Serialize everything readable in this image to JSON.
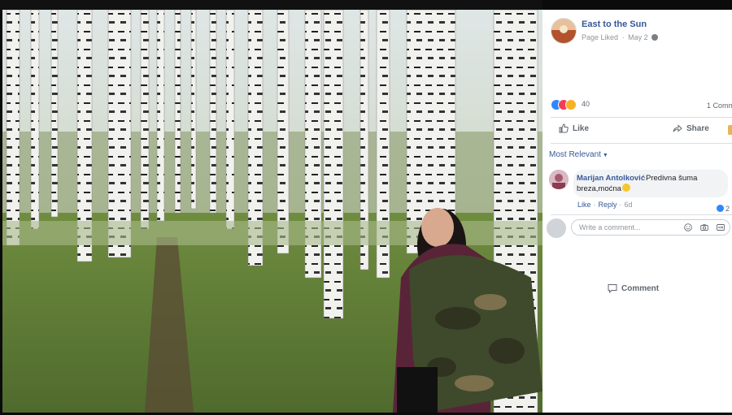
{
  "page": {
    "name": "East to the Sun",
    "status": "Page Liked",
    "separator": "·",
    "date": "May 2"
  },
  "reactions": {
    "count": "40",
    "comments_label": "1 Comm",
    "types": [
      "like",
      "love",
      "wow"
    ]
  },
  "actions": {
    "like": "Like",
    "comment": "Comment",
    "share": "Share"
  },
  "sort": {
    "label": "Most Relevant",
    "caret": "▼"
  },
  "comment": {
    "author": "Marijan Antolković",
    "text_line1": "Predivna šuma",
    "text_line2": "breza,moćna",
    "like_label": "Like",
    "reply_label": "Reply",
    "separator": "·",
    "time": "6d",
    "reaction_count": "2"
  },
  "composer": {
    "placeholder": "Write a comment..."
  },
  "colors": {
    "link_blue": "#385898",
    "page_name_blue": "#365899",
    "like_reaction": "#2d88ff",
    "love_reaction": "#f33e58",
    "wow_reaction": "#f7b125"
  }
}
